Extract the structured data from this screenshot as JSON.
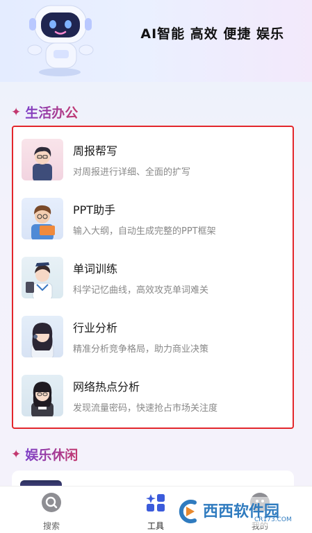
{
  "header": {
    "slogan": "AI智能 高效 便捷 娱乐"
  },
  "sections": [
    {
      "title": "生活办公",
      "items": [
        {
          "title": "周报帮写",
          "desc": "对周报进行详细、全面的扩写",
          "avatar": "person-avatar-icon"
        },
        {
          "title": "PPT助手",
          "desc": "输入大纲，自动生成完整的PPT框架",
          "avatar": "person-avatar-icon"
        },
        {
          "title": "单词训练",
          "desc": "科学记忆曲线，高效攻克单词难关",
          "avatar": "person-avatar-icon"
        },
        {
          "title": "行业分析",
          "desc": "精准分析竞争格局，助力商业决策",
          "avatar": "person-avatar-icon"
        },
        {
          "title": "网络热点分析",
          "desc": "发现流量密码，快速抢占市场关注度",
          "avatar": "person-avatar-icon"
        }
      ]
    },
    {
      "title": "娱乐休闲"
    }
  ],
  "tabbar": {
    "tabs": [
      {
        "label": "搜索",
        "icon": "search-icon"
      },
      {
        "label": "工具",
        "icon": "grid-tools-icon",
        "active": true
      },
      {
        "label": "我的",
        "icon": "profile-icon"
      }
    ]
  },
  "watermark": {
    "text": "西西软件园",
    "sub": "CR173.COM"
  },
  "colors": {
    "accent": "#3b5bdb",
    "highlight_border": "#e3262b",
    "section_title": "#a23a9a"
  }
}
